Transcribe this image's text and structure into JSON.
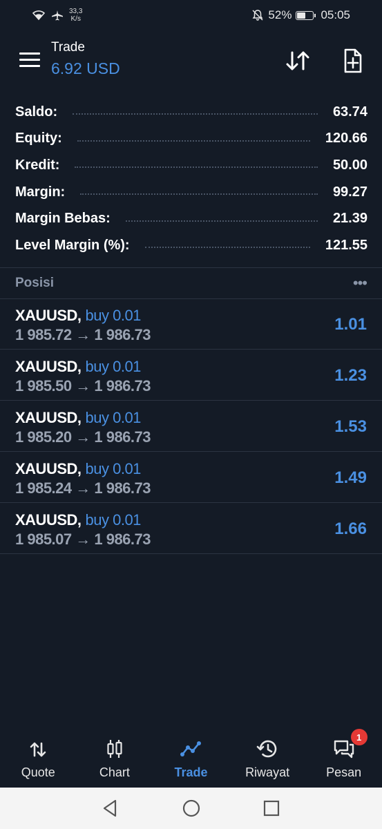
{
  "status_bar": {
    "speed": "33,3",
    "speed_unit": "K/s",
    "battery": "52%",
    "battery_level": 0.52,
    "time": "05:05"
  },
  "header": {
    "title": "Trade",
    "balance": "6.92 USD",
    "icons": [
      "menu-icon",
      "sort-icon",
      "new-order-icon"
    ]
  },
  "summary": [
    {
      "label": "Saldo:",
      "value": "63.74"
    },
    {
      "label": "Equity:",
      "value": "120.66"
    },
    {
      "label": "Kredit:",
      "value": "50.00"
    },
    {
      "label": "Margin:",
      "value": "99.27"
    },
    {
      "label": "Margin Bebas:",
      "value": "21.39"
    },
    {
      "label": "Level Margin (%):",
      "value": "121.55"
    }
  ],
  "positions": {
    "title": "Posisi",
    "more": "•••",
    "items": [
      {
        "symbol": "XAUUSD,",
        "side": "buy 0.01",
        "prices": "1 985.72 → 1 986.73",
        "profit": "1.01"
      },
      {
        "symbol": "XAUUSD,",
        "side": "buy 0.01",
        "prices": "1 985.50 → 1 986.73",
        "profit": "1.23"
      },
      {
        "symbol": "XAUUSD,",
        "side": "buy 0.01",
        "prices": "1 985.20 → 1 986.73",
        "profit": "1.53"
      },
      {
        "symbol": "XAUUSD,",
        "side": "buy 0.01",
        "prices": "1 985.24 → 1 986.73",
        "profit": "1.49"
      },
      {
        "symbol": "XAUUSD,",
        "side": "buy 0.01",
        "prices": "1 985.07 → 1 986.73",
        "profit": "1.66"
      }
    ]
  },
  "bottom_nav": [
    {
      "label": "Quote",
      "icon": "quote-icon"
    },
    {
      "label": "Chart",
      "icon": "chart-icon"
    },
    {
      "label": "Trade",
      "icon": "trade-icon",
      "active": true
    },
    {
      "label": "Riwayat",
      "icon": "history-icon"
    },
    {
      "label": "Pesan",
      "icon": "messages-icon",
      "badge": "1"
    }
  ],
  "colors": {
    "background": "#141b26",
    "accent": "#4a90e2",
    "muted": "#8a95a8",
    "badge": "#e53935"
  }
}
